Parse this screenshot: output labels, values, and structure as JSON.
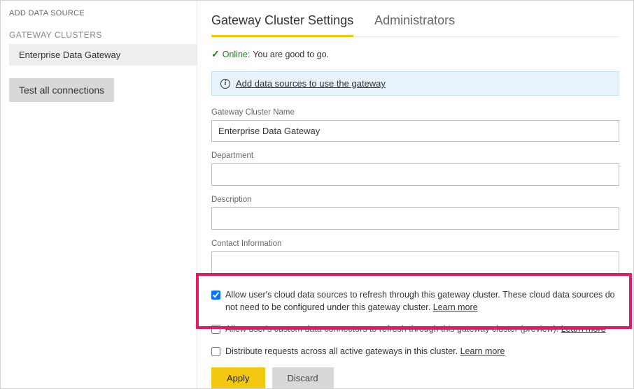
{
  "sidebar": {
    "add_link": "ADD DATA SOURCE",
    "section_title": "GATEWAY CLUSTERS",
    "cluster_item": "Enterprise Data Gateway",
    "test_btn": "Test all connections"
  },
  "tabs": {
    "settings": "Gateway Cluster Settings",
    "admins": "Administrators"
  },
  "status": {
    "label": "Online:",
    "text": "You are good to go."
  },
  "banner": {
    "link": "Add data sources to use the gateway"
  },
  "fields": {
    "name_label": "Gateway Cluster Name",
    "name_value": "Enterprise Data Gateway",
    "dept_label": "Department",
    "dept_value": "",
    "desc_label": "Description",
    "desc_value": "",
    "contact_label": "Contact Information",
    "contact_value": ""
  },
  "options": {
    "cloud_refresh": "Allow user's cloud data sources to refresh through this gateway cluster. These cloud data sources do not need to be configured under this gateway cluster.",
    "custom_connectors": "Allow user's custom data connectors to refresh through this gateway cluster (preview).",
    "distribute": "Distribute requests across all active gateways in this cluster.",
    "learn_more": "Learn more"
  },
  "buttons": {
    "apply": "Apply",
    "discard": "Discard"
  }
}
